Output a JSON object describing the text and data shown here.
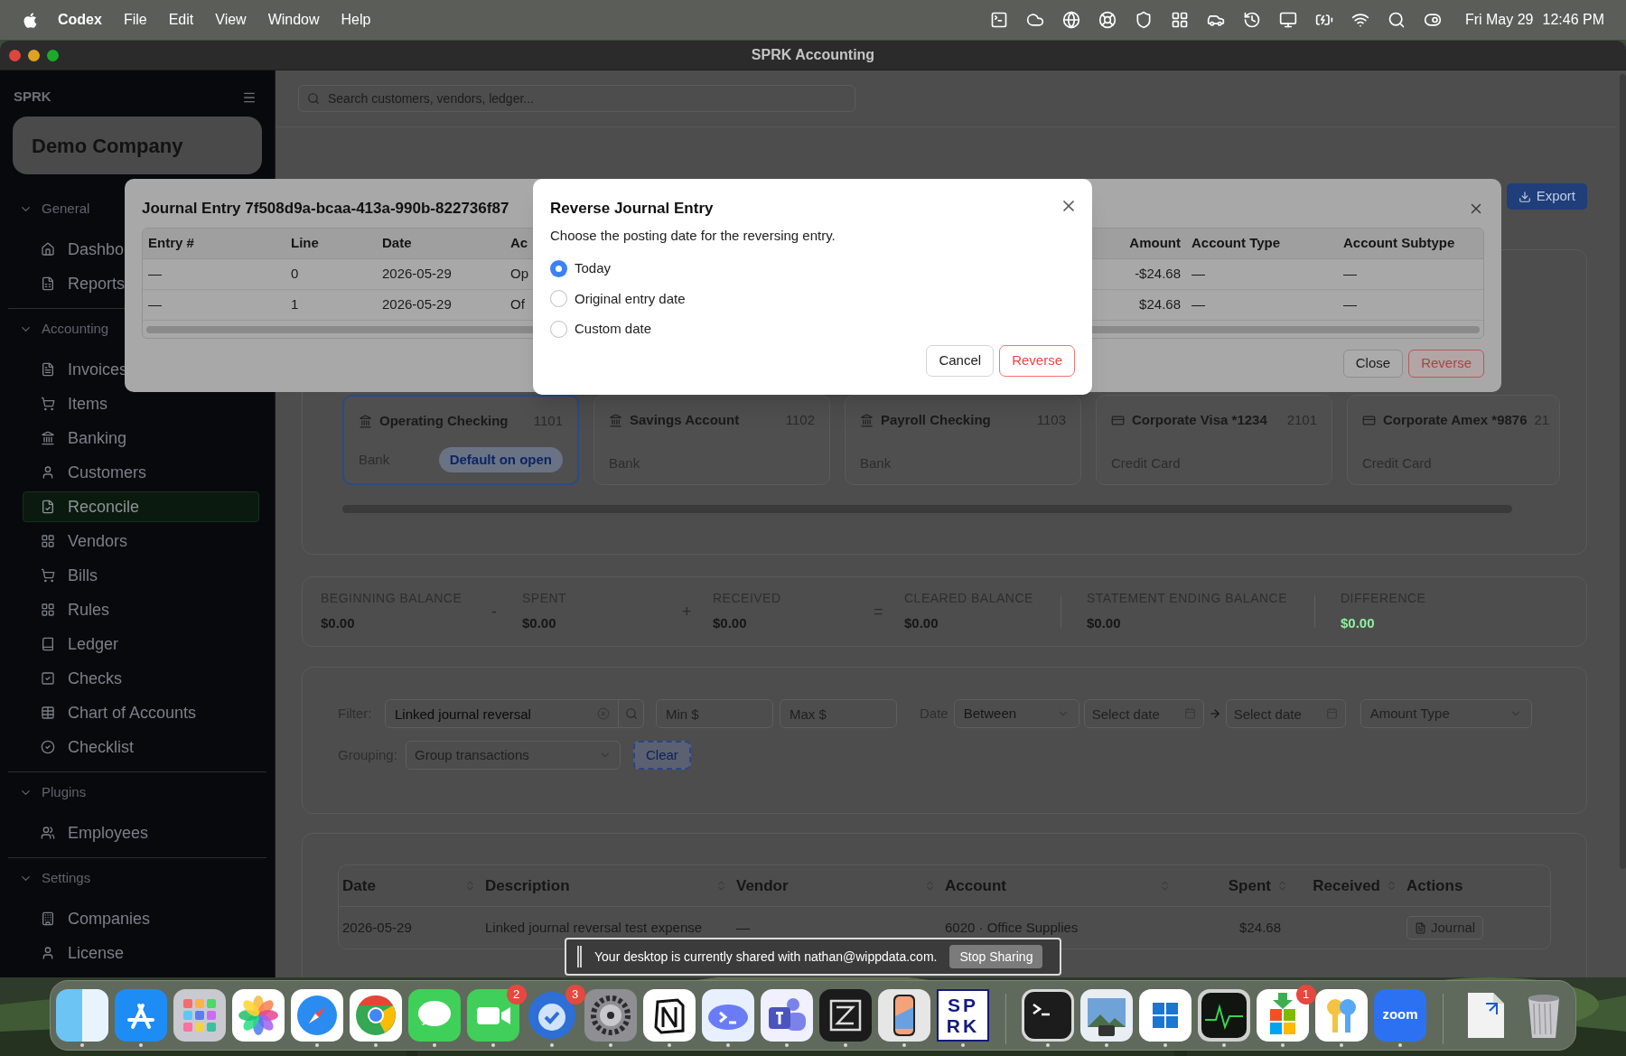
{
  "menu_bar": {
    "app": "Codex",
    "menus": [
      "File",
      "Edit",
      "View",
      "Window",
      "Help"
    ],
    "date": "Fri May 29",
    "time": "12:46 PM"
  },
  "window": {
    "title": "SPRK Accounting"
  },
  "sidebar": {
    "brand": "SPRK",
    "company": "Demo Company",
    "sections": [
      {
        "title": "General",
        "expanded": true,
        "items": [
          {
            "label": "Dashbo",
            "selected": false
          },
          {
            "label": "Reports",
            "selected": false
          }
        ]
      },
      {
        "title": "Accounting",
        "expanded": true,
        "items": [
          {
            "label": "Invoices",
            "selected": false
          },
          {
            "label": "Items",
            "selected": false
          },
          {
            "label": "Banking",
            "selected": false
          },
          {
            "label": "Customers",
            "selected": false
          },
          {
            "label": "Reconcile",
            "selected": true
          },
          {
            "label": "Vendors",
            "selected": false
          },
          {
            "label": "Bills",
            "selected": false
          },
          {
            "label": "Rules",
            "selected": false
          },
          {
            "label": "Ledger",
            "selected": false
          },
          {
            "label": "Checks",
            "selected": false
          },
          {
            "label": "Chart of Accounts",
            "selected": false
          },
          {
            "label": "Checklist",
            "selected": false
          }
        ]
      },
      {
        "title": "Plugins",
        "expanded": true,
        "items": [
          {
            "label": "Employees",
            "selected": false
          }
        ]
      },
      {
        "title": "Settings",
        "expanded": true,
        "items": [
          {
            "label": "Companies",
            "selected": false
          },
          {
            "label": "License",
            "selected": false
          }
        ]
      }
    ]
  },
  "search": {
    "placeholder": "Search customers, vendors, ledger..."
  },
  "export_button": "Export",
  "accounts": [
    {
      "name": "Operating Checking",
      "number": "1101",
      "type": "Bank",
      "kind": "bank",
      "selected": true,
      "badge": "Default on open"
    },
    {
      "name": "Savings Account",
      "number": "1102",
      "type": "Bank",
      "kind": "bank",
      "selected": false
    },
    {
      "name": "Payroll Checking",
      "number": "1103",
      "type": "Bank",
      "kind": "bank",
      "selected": false
    },
    {
      "name": "Corporate Visa *1234",
      "number": "2101",
      "type": "Credit Card",
      "kind": "card",
      "selected": false
    },
    {
      "name": "Corporate Amex *9876",
      "number": "21",
      "type": "Credit Card",
      "kind": "card",
      "selected": false
    }
  ],
  "balances": [
    {
      "label": "BEGINNING BALANCE",
      "value": "$0.00",
      "operator": "-",
      "kind": "amount"
    },
    {
      "label": "SPENT",
      "value": "$0.00",
      "operator": "+",
      "kind": "amount"
    },
    {
      "label": "RECEIVED",
      "value": "$0.00",
      "operator": "=",
      "kind": "amount"
    },
    {
      "label": "CLEARED BALANCE",
      "value": "$0.00",
      "kind": "amount"
    },
    {
      "label": "STATEMENT ENDING BALANCE",
      "value": "$0.00",
      "kind": "amount"
    },
    {
      "label": "DIFFERENCE",
      "value": "$0.00",
      "kind": "difference"
    }
  ],
  "filter": {
    "label": "Filter:",
    "value": "Linked journal reversal",
    "min_placeholder": "Min $",
    "max_placeholder": "Max $",
    "date_label": "Date",
    "date_mode": "Between",
    "from_placeholder": "Select date",
    "to_placeholder": "Select date",
    "amount_type_placeholder": "Amount Type",
    "grouping_label": "Grouping:",
    "grouping_placeholder": "Group transactions",
    "clear_button": "Clear"
  },
  "table": {
    "columns": [
      {
        "label": "Date",
        "sortable": true
      },
      {
        "label": "Description",
        "sortable": true
      },
      {
        "label": "Vendor",
        "sortable": true
      },
      {
        "label": "Account",
        "sortable": true
      },
      {
        "label": "Spent",
        "sortable": true
      },
      {
        "label": "Received",
        "sortable": true
      },
      {
        "label": "Actions",
        "sortable": false
      }
    ],
    "rows": [
      {
        "date": "2026-05-29",
        "description": "Linked journal reversal test expense",
        "vendor": "—",
        "account": "6020 · Office Supplies",
        "spent": "$24.68",
        "action": "Journal"
      }
    ]
  },
  "journal_dialog": {
    "title": "Journal Entry 7f508d9a-bcaa-413a-990b-822736f87",
    "columns": [
      "Entry #",
      "Line",
      "Date",
      "Ac",
      "Amount",
      "Account Type",
      "Account Subtype"
    ],
    "rows": [
      [
        "—",
        "0",
        "2026-05-29",
        "Op",
        "-$24.68",
        "—",
        "—"
      ],
      [
        "—",
        "1",
        "2026-05-29",
        "Of",
        "$24.68",
        "—",
        "—"
      ]
    ],
    "buttons": [
      {
        "label": "Close",
        "kind": "secondary"
      },
      {
        "label": "Reverse",
        "kind": "danger"
      }
    ]
  },
  "reverse_dialog": {
    "title": "Reverse Journal Entry",
    "description": "Choose the posting date for the reversing entry.",
    "options": [
      {
        "label": "Today",
        "selected": true
      },
      {
        "label": "Original entry date",
        "selected": false
      },
      {
        "label": "Custom date",
        "selected": false
      }
    ],
    "buttons": [
      {
        "label": "Cancel",
        "kind": "secondary"
      },
      {
        "label": "Reverse",
        "kind": "danger"
      }
    ]
  },
  "sharing_bar": {
    "message": "Your desktop is currently shared with nathan@wippdata.com.",
    "button": "Stop Sharing"
  },
  "dock": {
    "items": [
      {
        "kind": "finder",
        "running": true
      },
      {
        "kind": "appstore",
        "running": true
      },
      {
        "kind": "launchpad",
        "running": false
      },
      {
        "kind": "photos",
        "running": false
      },
      {
        "kind": "safari",
        "running": true
      },
      {
        "kind": "chrome",
        "running": true
      },
      {
        "kind": "messages",
        "running": true
      },
      {
        "kind": "facetime",
        "running": true,
        "badge": "2"
      },
      {
        "kind": "mail",
        "running": true,
        "badge": "3"
      },
      {
        "kind": "settings",
        "running": true
      },
      {
        "kind": "notion",
        "running": true
      },
      {
        "kind": "prompt",
        "running": true
      },
      {
        "kind": "teams",
        "running": true
      },
      {
        "kind": "zed",
        "running": true
      },
      {
        "kind": "phone",
        "running": true
      },
      {
        "kind": "text",
        "label": "SPRK",
        "running": true
      },
      {
        "kind": "separator"
      },
      {
        "kind": "terminal",
        "running": true
      },
      {
        "kind": "preview",
        "running": true
      },
      {
        "kind": "windows",
        "running": true
      },
      {
        "kind": "activity",
        "running": true
      },
      {
        "kind": "store",
        "running": true,
        "badge": "1"
      },
      {
        "kind": "keys",
        "running": true
      },
      {
        "kind": "zoom",
        "label": "zoom",
        "running": true
      },
      {
        "kind": "separator"
      },
      {
        "kind": "document",
        "running": false
      },
      {
        "kind": "trash",
        "running": false
      }
    ]
  }
}
